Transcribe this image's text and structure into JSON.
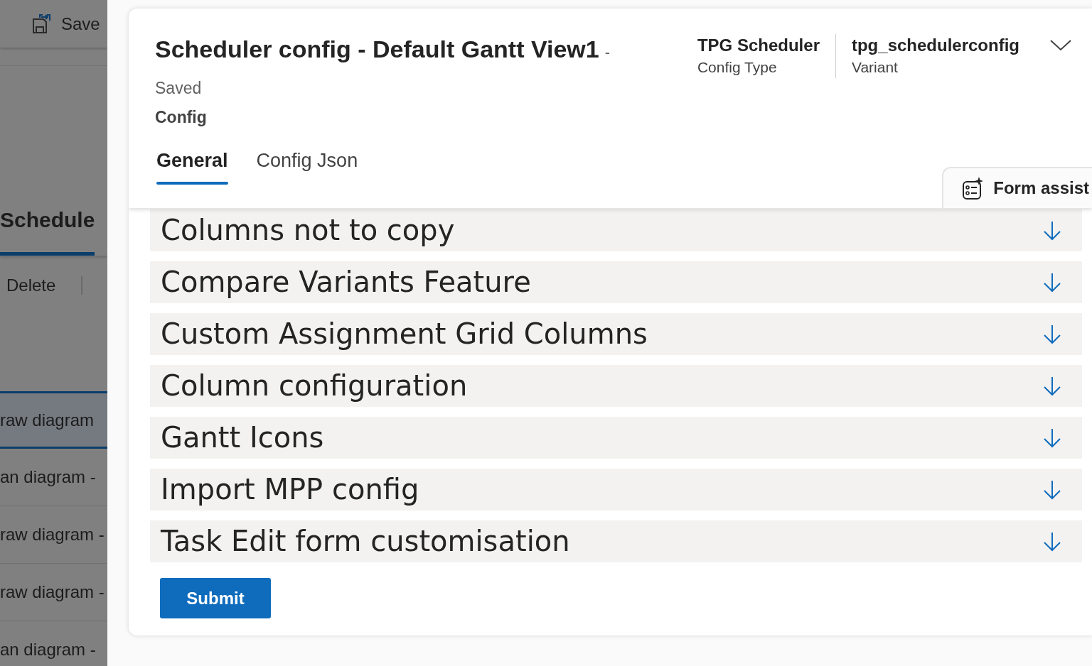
{
  "background_page": {
    "toolbar": {
      "save_label": "Save"
    },
    "tabs": [
      {
        "label": "Schedule",
        "selected": true
      }
    ],
    "commands": [
      "Delete"
    ],
    "rows": [
      {
        "label": "raw diagram",
        "selected": true
      },
      {
        "label": "an diagram -",
        "selected": false
      },
      {
        "label": "raw diagram -",
        "selected": false
      },
      {
        "label": "raw diagram -",
        "selected": false
      },
      {
        "label": "an diagram -",
        "selected": false
      }
    ]
  },
  "dialog": {
    "title": "Scheduler config - Default Gantt View1",
    "title_suffix": "-",
    "status": "Saved",
    "entity": "Config",
    "header_fields": [
      {
        "value": "TPG Scheduler",
        "label": "Config Type"
      },
      {
        "value": "tpg_schedulerconfig",
        "label": "Variant"
      }
    ],
    "tabs": [
      {
        "label": "General",
        "selected": true
      },
      {
        "label": "Config Json",
        "selected": false
      }
    ],
    "form_assist": "Form assist",
    "sections": [
      {
        "title": "Columns not to copy"
      },
      {
        "title": "Compare Variants Feature"
      },
      {
        "title": "Custom Assignment Grid Columns"
      },
      {
        "title": "Column configuration"
      },
      {
        "title": "Gantt Icons"
      },
      {
        "title": "Import MPP config"
      },
      {
        "title": "Task Edit form customisation"
      }
    ],
    "submit": "Submit"
  }
}
